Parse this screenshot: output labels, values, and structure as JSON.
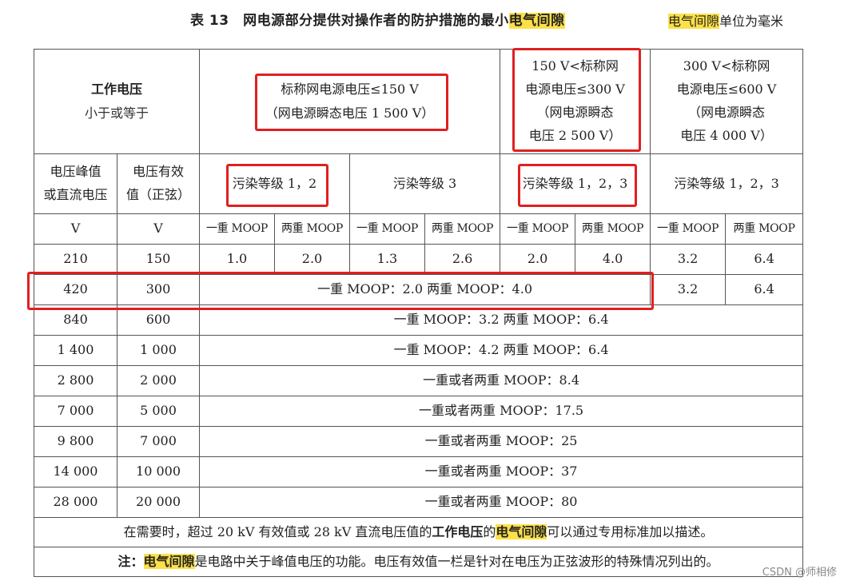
{
  "title": {
    "prefix": "表 13　网电源部分提供对操作者的防护措施的最小",
    "highlight": "电气间隙",
    "unit_highlight": "电气间隙",
    "unit_rest": "单位为毫米"
  },
  "header": {
    "working_voltage_line1": "工作电压",
    "working_voltage_line2": "小于或等于",
    "range1_line1": "标称网电源电压≤150 V",
    "range1_line2": "（网电源瞬态电压 1 500 V）",
    "range2_line1": "150 V<标称网",
    "range2_line2": "电源电压≤300 V",
    "range2_line3": "（网电源瞬态",
    "range2_line4": "电压 2 500 V）",
    "range3_line1": "300 V<标称网",
    "range3_line2": "电源电压≤600 V",
    "range3_line3": "（网电源瞬态",
    "range3_line4": "电压 4 000 V）",
    "peak_line1": "电压峰值",
    "peak_line2": "或直流电压",
    "rms_line1": "电压有效",
    "rms_line2": "值（正弦）",
    "pd12": "污染等级 1，2",
    "pd3": "污染等级 3",
    "pd123a": "污染等级 1，2，3",
    "pd123b": "污染等级 1，2，3",
    "unit_v1": "V",
    "unit_v2": "V",
    "moop": [
      "一重 MOOP",
      "两重 MOOP",
      "一重 MOOP",
      "两重 MOOP",
      "一重 MOOP",
      "两重 MOOP",
      "一重 MOOP",
      "两重 MOOP"
    ]
  },
  "rows": {
    "r1": {
      "peak": "210",
      "rms": "150",
      "values": [
        "1.0",
        "2.0",
        "1.3",
        "2.6",
        "2.0",
        "4.0",
        "3.2",
        "6.4"
      ]
    },
    "r2": {
      "peak": "420",
      "rms": "300",
      "merged": "一重 MOOP：2.0 两重 MOOP：4.0",
      "v7": "3.2",
      "v8": "6.4"
    },
    "r3": {
      "peak": "840",
      "rms": "600",
      "merged": "一重 MOOP：3.2 两重 MOOP：6.4"
    },
    "r4": {
      "peak": "1 400",
      "rms": "1 000",
      "merged": "一重 MOOP：4.2 两重 MOOP：6.4"
    },
    "r5": {
      "peak": "2 800",
      "rms": "2 000",
      "merged": "一重或者两重 MOOP：8.4"
    },
    "r6": {
      "peak": "7 000",
      "rms": "5 000",
      "merged": "一重或者两重 MOOP：17.5"
    },
    "r7": {
      "peak": "9 800",
      "rms": "7 000",
      "merged": "一重或者两重 MOOP：25"
    },
    "r8": {
      "peak": "14 000",
      "rms": "10 000",
      "merged": "一重或者两重 MOOP：37"
    },
    "r9": {
      "peak": "28 000",
      "rms": "20 000",
      "merged": "一重或者两重 MOOP：80"
    }
  },
  "notes": {
    "line1_a": "在需要时，超过 20 kV 有效值或 28 kV 直流电压值的",
    "line1_b": "工作电压",
    "line1_c": "的",
    "line1_d": "电气间隙",
    "line1_e": "可以通过专用标准加以描述。",
    "line2_a": "注：",
    "line2_b": "电气间隙",
    "line2_c": "是电路中关于峰值电压的功能。电压有效值一栏是针对在电压为正弦波形的特殊情况列出的。"
  },
  "watermark": "CSDN @师相修"
}
